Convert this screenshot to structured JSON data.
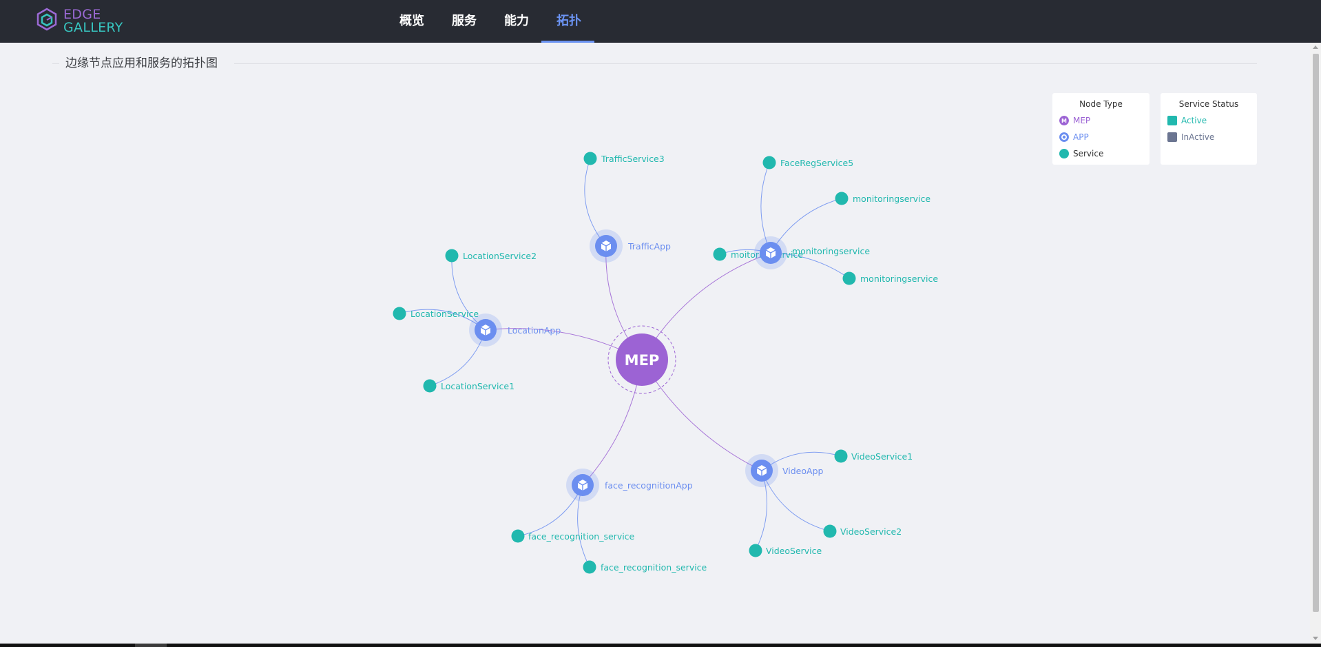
{
  "brand": {
    "line1": "EDGE",
    "line2": "GALLERY",
    "color1": "#9c6ad6",
    "color2": "#37c4bf"
  },
  "nav": {
    "items": [
      {
        "label": "概览"
      },
      {
        "label": "服务"
      },
      {
        "label": "能力"
      },
      {
        "label": "拓扑",
        "active": true
      }
    ],
    "active_color": "#6b93f2"
  },
  "page": {
    "title": "边缘节点应用和服务的拓扑图"
  },
  "legend_node_type": {
    "title": "Node Type",
    "items": [
      {
        "label": "MEP",
        "color": "#9c63d4",
        "icon": "mep-icon"
      },
      {
        "label": "APP",
        "color": "#6b8ef0",
        "icon": "app-icon"
      },
      {
        "label": "Service",
        "color": "#21b8ae",
        "icon": "service-icon"
      }
    ]
  },
  "legend_service_status": {
    "title": "Service Status",
    "items": [
      {
        "label": "Active",
        "color": "#21b8ae"
      },
      {
        "label": "InActive",
        "color": "#6b7591"
      }
    ]
  },
  "topology": {
    "colors": {
      "mep": "#9c63d4",
      "app": "#6b8ef0",
      "service": "#21b8ae",
      "edge_mep": "#9c63d4",
      "edge_app": "#6b8ef0"
    },
    "mep": {
      "label": "MEP"
    },
    "apps": [
      {
        "label": "TrafficApp"
      },
      {
        "label": "LocationApp"
      },
      {
        "label": "face_recognitionApp"
      },
      {
        "label": "VideoApp"
      },
      {
        "label": ""
      }
    ],
    "services": [
      {
        "label": "TrafficService3",
        "app": 0
      },
      {
        "label": "LocationService2",
        "app": 1
      },
      {
        "label": "LocationService",
        "app": 1
      },
      {
        "label": "LocationService1",
        "app": 1
      },
      {
        "label": "face_recognition_service",
        "app": 2
      },
      {
        "label": "face_recognition_service",
        "app": 2
      },
      {
        "label": "VideoService1",
        "app": 3
      },
      {
        "label": "VideoService2",
        "app": 3
      },
      {
        "label": "VideoService",
        "app": 3
      },
      {
        "label": "FaceRegService5",
        "app": 4
      },
      {
        "label": "monitoringservice",
        "app": 4
      },
      {
        "label": "monitoringservice",
        "app": 4
      },
      {
        "label": "moitoringservice",
        "app": 4
      },
      {
        "label": "monitoringservice",
        "app": 4
      }
    ]
  }
}
